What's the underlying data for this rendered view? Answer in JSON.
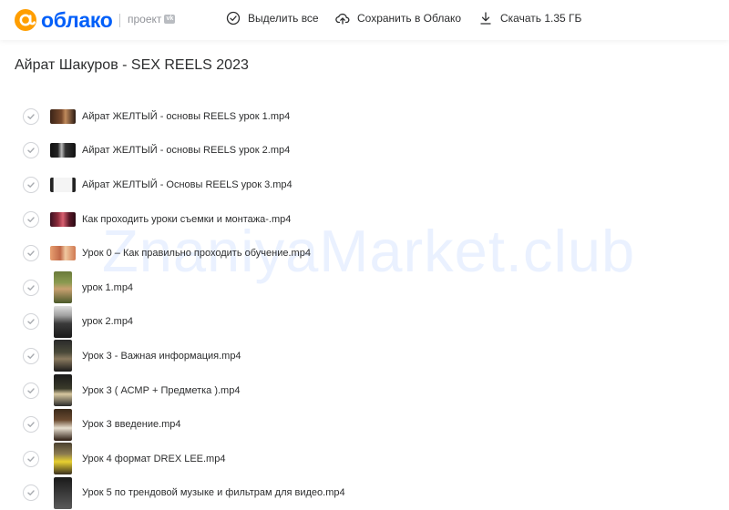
{
  "header": {
    "logo_text": "облако",
    "logo_sub": "проект",
    "vk_badge": "vk",
    "select_all": "Выделить все",
    "save_to_cloud": "Сохранить в Облако",
    "download": "Скачать 1.35 ГБ"
  },
  "folder_title": "Айрат Шакуров - SEX REELS 2023",
  "files": [
    {
      "name": "Айрат ЖЕЛТЫЙ - основы REELS урок 1.mp4"
    },
    {
      "name": "Айрат ЖЕЛТЫЙ - основы REELS урок 2.mp4"
    },
    {
      "name": "Айрат ЖЕЛТЫЙ - Основы REELS урок 3.mp4"
    },
    {
      "name": "Как проходить уроки съемки и монтажа-.mp4"
    },
    {
      "name": "Урок 0 – Как правильно проходить обучение.mp4"
    },
    {
      "name": "урок 1.mp4"
    },
    {
      "name": "урок 2.mp4"
    },
    {
      "name": "Урок 3 - Важная информация.mp4"
    },
    {
      "name": "Урок 3 ( АСМР + Предметка ).mp4"
    },
    {
      "name": "Урок 3 введение.mp4"
    },
    {
      "name": "Урок 4 формат DREX LEE.mp4"
    },
    {
      "name": "Урок 5 по трендовой музыке и фильтрам для видео.mp4"
    }
  ],
  "watermark": "ZnaniyaMarket.club",
  "colors": {
    "brand": "#005ff9",
    "logo_at": "#ff9e00",
    "text": "#2c2d2e"
  }
}
